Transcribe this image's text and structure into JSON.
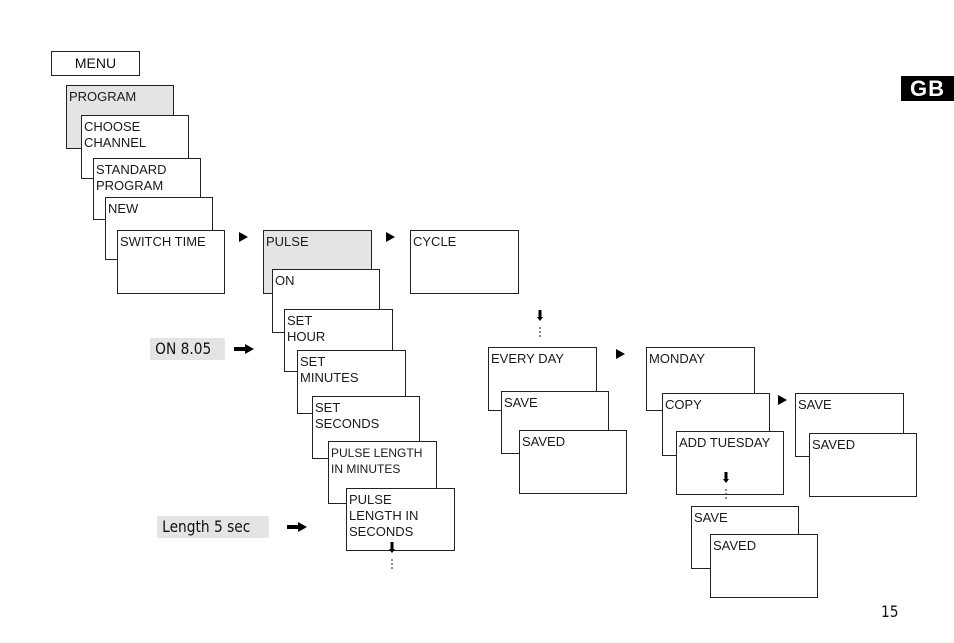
{
  "header": {
    "menu_label": "MENU",
    "language_badge": "GB"
  },
  "menu_chain": [
    {
      "label": "PROGRAM",
      "highlighted": true
    },
    {
      "label": "CHOOSE\nCHANNEL"
    },
    {
      "label": "STANDARD\nPROGRAM"
    },
    {
      "label": "NEW"
    },
    {
      "label": "SWITCH TIME"
    }
  ],
  "pulse_chain": [
    {
      "label": "PULSE",
      "highlighted": true
    },
    {
      "label": "ON"
    },
    {
      "label": "SET\nHOUR"
    },
    {
      "label": "SET\nMINUTES"
    },
    {
      "label": "SET\nSECONDS"
    },
    {
      "label": "PULSE LENGTH\nIN MINUTES"
    },
    {
      "label": "PULSE\nLENGTH IN\nSECONDS"
    }
  ],
  "cycle_box": {
    "label": "CYCLE"
  },
  "every_day_chain": [
    {
      "label": "EVERY DAY"
    },
    {
      "label": "SAVE"
    },
    {
      "label": "SAVED"
    }
  ],
  "monday_chain": [
    {
      "label": "MONDAY"
    },
    {
      "label": "COPY"
    },
    {
      "label": "ADD TUESDAY"
    }
  ],
  "copy_save_chain": [
    {
      "label": "SAVE"
    },
    {
      "label": "SAVED"
    }
  ],
  "tuesday_save_chain": [
    {
      "label": "SAVE"
    },
    {
      "label": "SAVED"
    }
  ],
  "annotations": {
    "on_time": "ON 8.05",
    "pulse_length": "Length 5 sec"
  },
  "icons": {
    "next_step": "right-triangle-icon",
    "set_value": "right-arrow-icon",
    "continue": "down-arrow-dots-icon"
  },
  "footer": {
    "page_number": "15"
  },
  "colors": {
    "highlight": "#e4e4e4",
    "border": "#222222",
    "badge_bg": "#000000"
  }
}
